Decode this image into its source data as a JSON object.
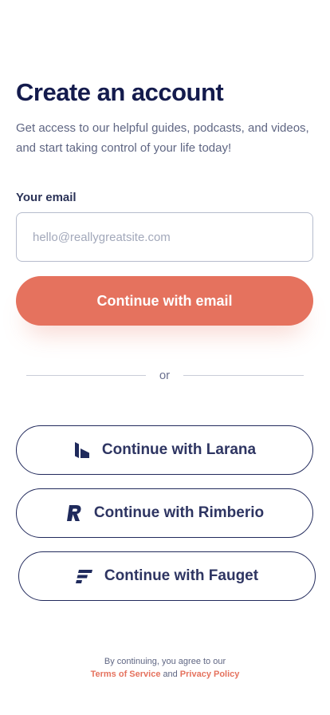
{
  "header": {
    "title": "Create an account",
    "subtitle": "Get access to our helpful guides, podcasts, and videos, and start taking control of your life today!"
  },
  "form": {
    "email_label": "Your email",
    "email_placeholder": "hello@reallygreatsite.com",
    "email_value": "",
    "submit_label": "Continue with email"
  },
  "divider": {
    "text": "or"
  },
  "social": [
    {
      "label": "Continue with Larana",
      "icon": "larana-logo-icon"
    },
    {
      "label": "Continue with Rimberio",
      "icon": "rimberio-logo-icon"
    },
    {
      "label": "Continue with Fauget",
      "icon": "fauget-logo-icon"
    }
  ],
  "legal": {
    "prefix": "By continuing, you agree to our",
    "terms": "Terms of Service",
    "and": "and",
    "privacy": "Privacy Policy"
  },
  "colors": {
    "accent": "#e5725e",
    "navy": "#141b4d",
    "border": "#b6bccd"
  }
}
